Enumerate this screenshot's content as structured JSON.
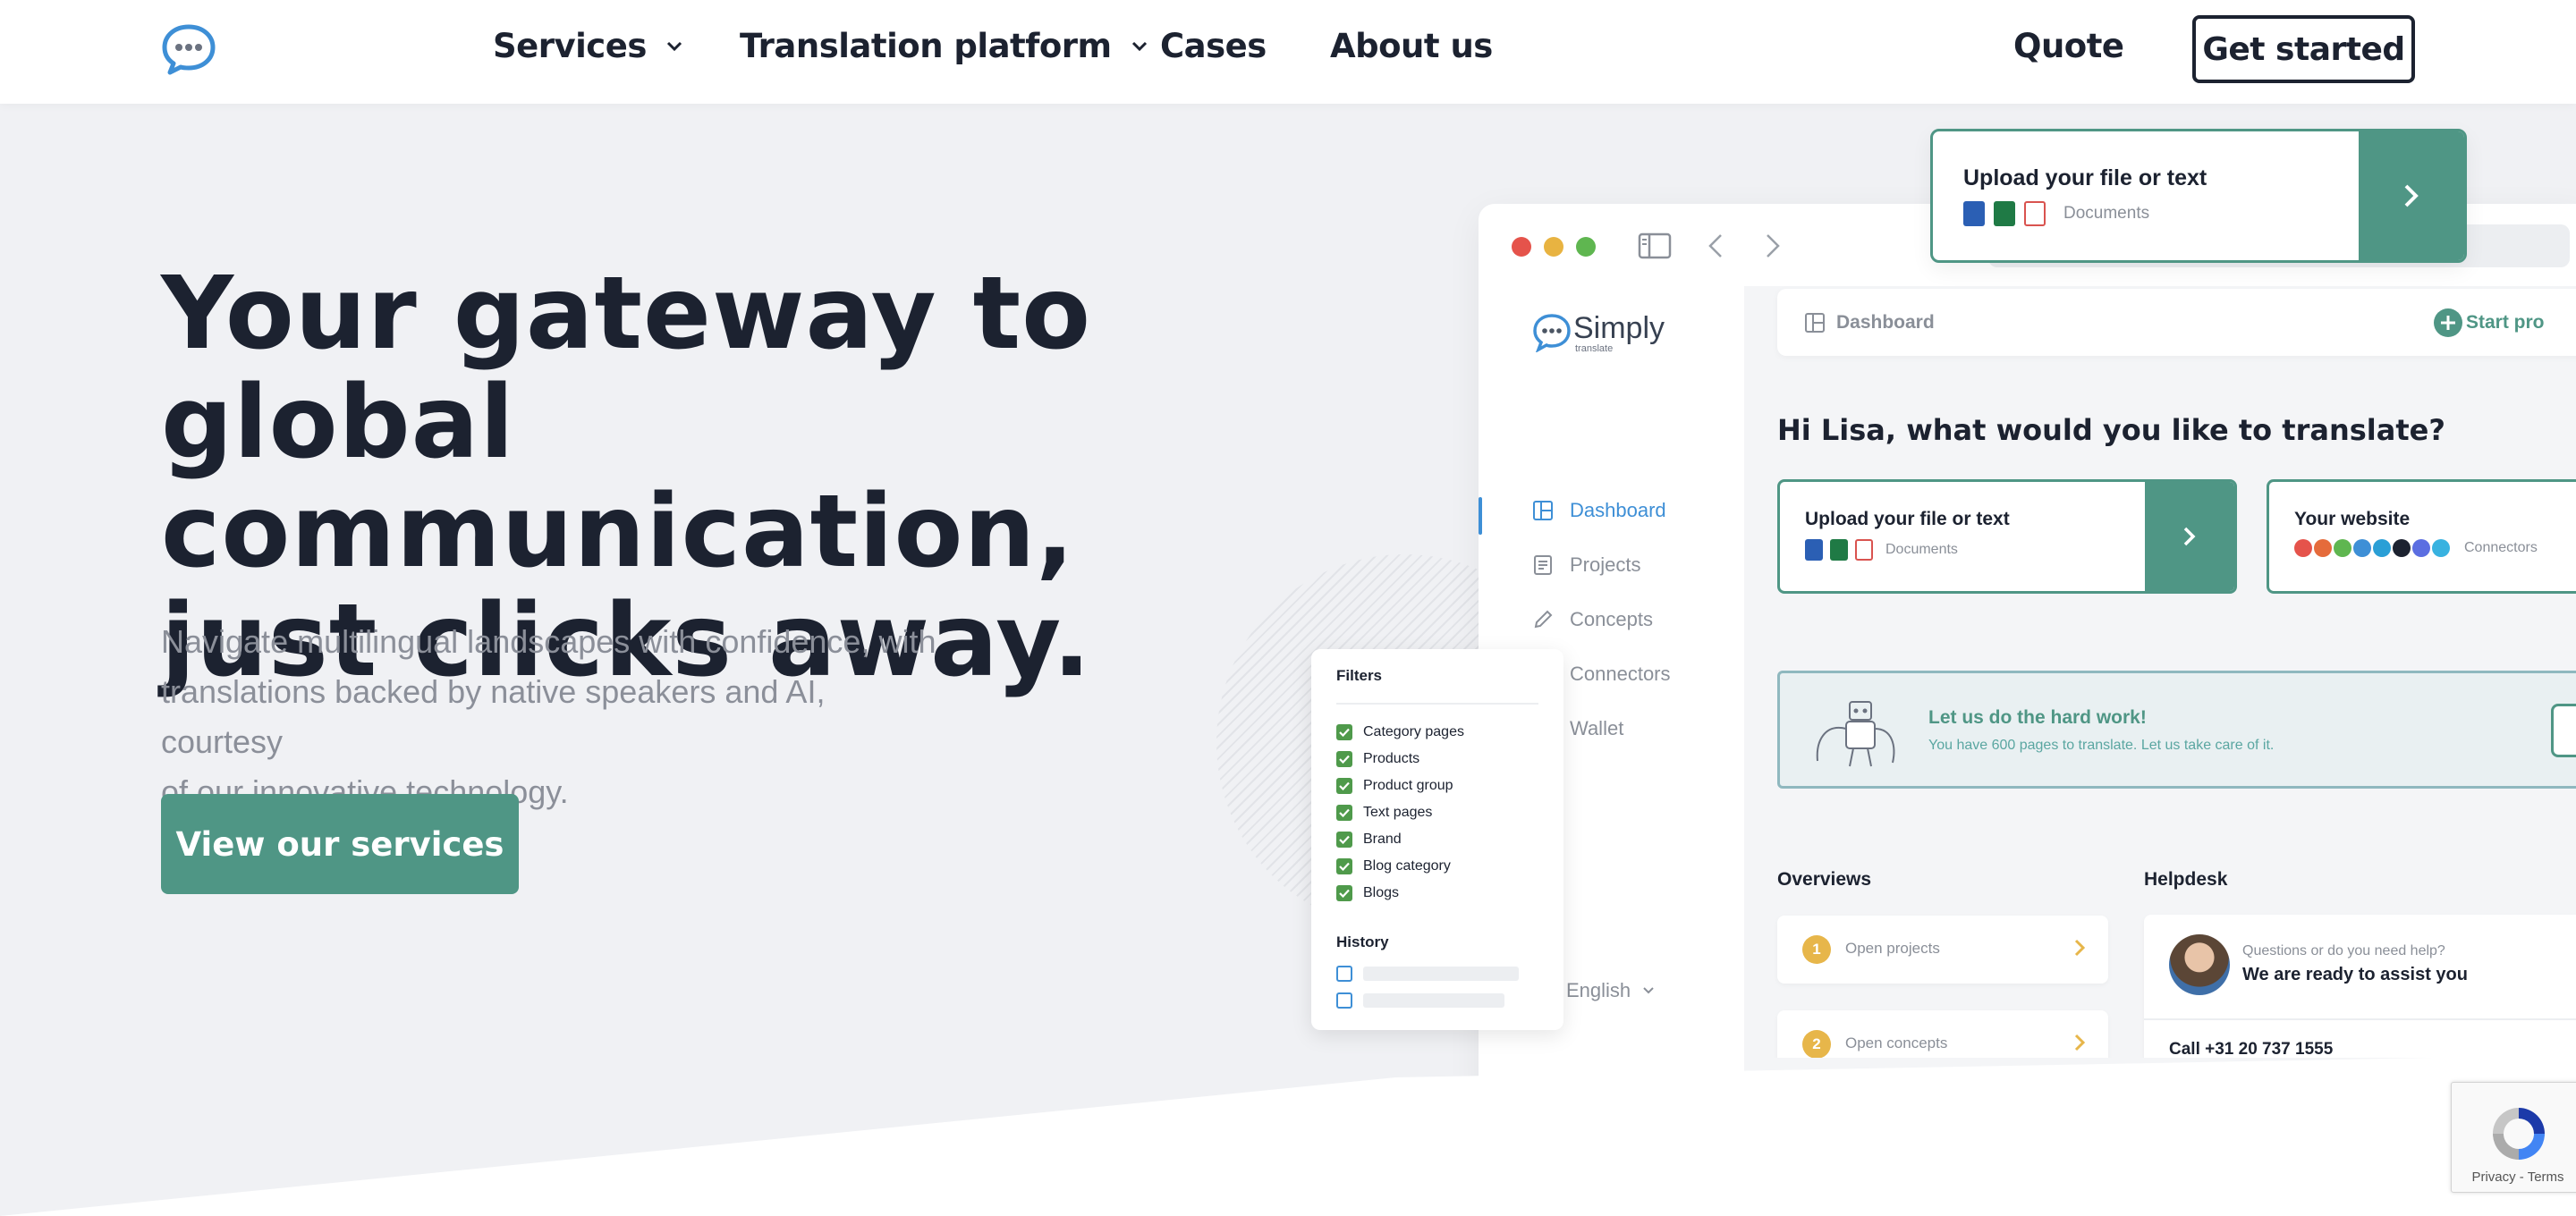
{
  "nav": {
    "items": [
      {
        "label": "Services",
        "has_dropdown": true
      },
      {
        "label": "Translation platform",
        "has_dropdown": true
      },
      {
        "label": "Cases",
        "has_dropdown": false
      },
      {
        "label": "About us",
        "has_dropdown": false
      }
    ],
    "quote_label": "Quote",
    "cta_label": "Get started"
  },
  "hero": {
    "title_line1": "Your gateway to",
    "title_line2": "global communication,",
    "title_line3": "just clicks away.",
    "subtitle_line1": "Navigate multilingual landscapes with confidence, with",
    "subtitle_line2": "translations backed by native speakers and AI, courtesy",
    "subtitle_line3": "of our innovative technology.",
    "cta_label": "View our services"
  },
  "floating_upload": {
    "title": "Upload your file or text",
    "meta": "Documents"
  },
  "app": {
    "brand": "Simply",
    "brand_sub": "translate",
    "sidebar": [
      {
        "label": "Dashboard",
        "icon": "dashboard-icon",
        "active": true
      },
      {
        "label": "Projects",
        "icon": "projects-icon",
        "active": false
      },
      {
        "label": "Concepts",
        "icon": "pencil-icon",
        "active": false
      },
      {
        "label": "Connectors",
        "icon": "connectors-icon",
        "active": false
      },
      {
        "label": "Wallet",
        "icon": "wallet-icon",
        "active": false
      }
    ],
    "language": "English",
    "breadcrumb": "Dashboard",
    "start_project": "Start pro",
    "greeting": "Hi Lisa, what would you like to translate?",
    "upload_card": {
      "title": "Upload your file or text",
      "meta": "Documents"
    },
    "website_card": {
      "title": "Your website",
      "meta": "Connectors"
    },
    "banner": {
      "title": "Let us do the hard work!",
      "subtitle": "You have 600 pages to translate. Let us take care of it."
    },
    "overviews_title": "Overviews",
    "overviews": [
      {
        "num": "1",
        "label": "Open projects"
      },
      {
        "num": "2",
        "label": "Open concepts"
      }
    ],
    "helpdesk_title": "Helpdesk",
    "helpdesk": {
      "question": "Questions or do you need help?",
      "answer": "We are ready to assist you",
      "phone": "Call +31 20 737 1555"
    }
  },
  "filters": {
    "title": "Filters",
    "items": [
      "Category pages",
      "Products",
      "Product group",
      "Text pages",
      "Brand",
      "Blog category",
      "Blogs"
    ],
    "history_title": "History"
  },
  "recaptcha": {
    "privacy": "Privacy",
    "separator": " - ",
    "terms": "Terms"
  },
  "colors": {
    "accent_teal": "#4f9685",
    "dark_text": "#1c2230",
    "link_blue": "#3e8fd6",
    "background": "#f0f1f4"
  }
}
